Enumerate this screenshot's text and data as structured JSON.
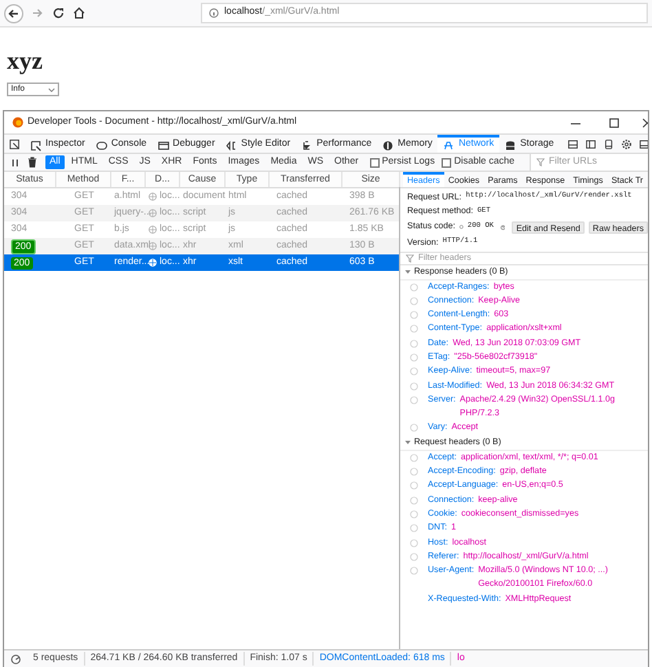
{
  "browser": {
    "url_host": "localhost",
    "url_path": "/_xml/GurV/a.html"
  },
  "page": {
    "heading": "xyz",
    "select_value": "Info"
  },
  "devtools": {
    "title": "Developer Tools - Document - http://localhost/_xml/GurV/a.html",
    "tools": [
      {
        "label": "Inspector",
        "selected": false
      },
      {
        "label": "Console",
        "selected": false
      },
      {
        "label": "Debugger",
        "selected": false
      },
      {
        "label": "Style Editor",
        "selected": false
      },
      {
        "label": "Performance",
        "selected": false
      },
      {
        "label": "Memory",
        "selected": false
      },
      {
        "label": "Network",
        "selected": true
      },
      {
        "label": "Storage",
        "selected": false
      }
    ],
    "filter_types": [
      {
        "label": "All",
        "selected": true
      },
      {
        "label": "HTML",
        "selected": false
      },
      {
        "label": "CSS",
        "selected": false
      },
      {
        "label": "JS",
        "selected": false
      },
      {
        "label": "XHR",
        "selected": false
      },
      {
        "label": "Fonts",
        "selected": false
      },
      {
        "label": "Images",
        "selected": false
      },
      {
        "label": "Media",
        "selected": false
      },
      {
        "label": "WS",
        "selected": false
      },
      {
        "label": "Other",
        "selected": false
      }
    ],
    "checkboxes": [
      {
        "label": "Persist Logs",
        "checked": false
      },
      {
        "label": "Disable cache",
        "checked": false
      }
    ],
    "filter_placeholder": "Filter URLs",
    "columns": [
      "Status",
      "Method",
      "F...",
      "D...",
      "Cause",
      "Type",
      "Transferred",
      "Size"
    ],
    "rows": [
      {
        "status": "304",
        "kind": "plain",
        "method": "GET",
        "file": "a.html",
        "domain": "loc...",
        "cause": "document",
        "type": "html",
        "transferred": "cached",
        "size": "398 B",
        "selected": false
      },
      {
        "status": "304",
        "kind": "plain",
        "method": "GET",
        "file": "jquery-...",
        "domain": "loc...",
        "cause": "script",
        "type": "js",
        "transferred": "cached",
        "size": "261.76 KB",
        "selected": false
      },
      {
        "status": "304",
        "kind": "plain",
        "method": "GET",
        "file": "b.js",
        "domain": "loc...",
        "cause": "script",
        "type": "js",
        "transferred": "cached",
        "size": "1.85 KB",
        "selected": false
      },
      {
        "status": "200",
        "kind": "badge",
        "method": "GET",
        "file": "data.xml",
        "domain": "loc...",
        "cause": "xhr",
        "type": "xml",
        "transferred": "cached",
        "size": "130 B",
        "selected": false
      },
      {
        "status": "200",
        "kind": "badge",
        "method": "GET",
        "file": "render...",
        "domain": "loc...",
        "cause": "xhr",
        "type": "xslt",
        "transferred": "cached",
        "size": "603 B",
        "selected": true
      }
    ],
    "detail_tabs": [
      {
        "label": "Headers",
        "selected": true
      },
      {
        "label": "Cookies",
        "selected": false
      },
      {
        "label": "Params",
        "selected": false
      },
      {
        "label": "Response",
        "selected": false
      },
      {
        "label": "Timings",
        "selected": false
      },
      {
        "label": "Stack Tr",
        "selected": false
      }
    ],
    "request": {
      "url_label": "Request URL:",
      "url": "http://localhost/_xml/GurV/render.xslt",
      "method_label": "Request method:",
      "method": "GET",
      "status_label": "Status code:",
      "status": "200 OK",
      "buttons": [
        "Edit and Resend",
        "Raw headers"
      ],
      "version_label": "Version:",
      "version": "HTTP/1.1"
    },
    "filter_headers_placeholder": "Filter headers",
    "sections": [
      {
        "title": "Response headers (0 B)",
        "expanded": true,
        "headers": [
          {
            "name": "Accept-Ranges:",
            "value": "bytes",
            "help": true
          },
          {
            "name": "Connection:",
            "value": "Keep-Alive",
            "help": true
          },
          {
            "name": "Content-Length:",
            "value": "603",
            "help": true
          },
          {
            "name": "Content-Type:",
            "value": "application/xslt+xml",
            "help": true
          },
          {
            "name": "Date:",
            "value": "Wed, 13 Jun 2018 07:03:09 GMT",
            "help": true
          },
          {
            "name": "ETag:",
            "value": "\"25b-56e802cf73918\"",
            "help": true
          },
          {
            "name": "Keep-Alive:",
            "value": "timeout=5, max=97",
            "help": true
          },
          {
            "name": "Last-Modified:",
            "value": "Wed, 13 Jun 2018 06:34:32 GMT",
            "help": true
          },
          {
            "name": "Server:",
            "value": "Apache/2.4.29 (Win32) OpenSSL/1.1.0g PHP/7.2.3",
            "help": true
          },
          {
            "name": "Vary:",
            "value": "Accept",
            "help": true
          }
        ]
      },
      {
        "title": "Request headers (0 B)",
        "expanded": true,
        "headers": [
          {
            "name": "Accept:",
            "value": "application/xml, text/xml, */*; q=0.01",
            "help": true
          },
          {
            "name": "Accept-Encoding:",
            "value": "gzip, deflate",
            "help": true
          },
          {
            "name": "Accept-Language:",
            "value": "en-US,en;q=0.5",
            "help": true
          },
          {
            "name": "Connection:",
            "value": "keep-alive",
            "help": true
          },
          {
            "name": "Cookie:",
            "value": "cookieconsent_dismissed=yes",
            "help": true
          },
          {
            "name": "DNT:",
            "value": "1",
            "help": true
          },
          {
            "name": "Host:",
            "value": "localhost",
            "help": true
          },
          {
            "name": "Referer:",
            "value": "http://localhost/_xml/GurV/a.html",
            "help": true
          },
          {
            "name": "User-Agent:",
            "value": "Mozilla/5.0 (Windows NT 10.0; ...) Gecko/20100101 Firefox/60.0",
            "help": true
          },
          {
            "name": "X-Requested-With:",
            "value": "XMLHttpRequest",
            "help": false
          }
        ]
      }
    ],
    "status_bar": {
      "requests": "5 requests",
      "size": "264.71 KB / 264.60 KB transferred",
      "finish": "Finish: 1.07 s",
      "dom": "DOMContentLoaded: 618 ms",
      "load": "lo"
    }
  }
}
